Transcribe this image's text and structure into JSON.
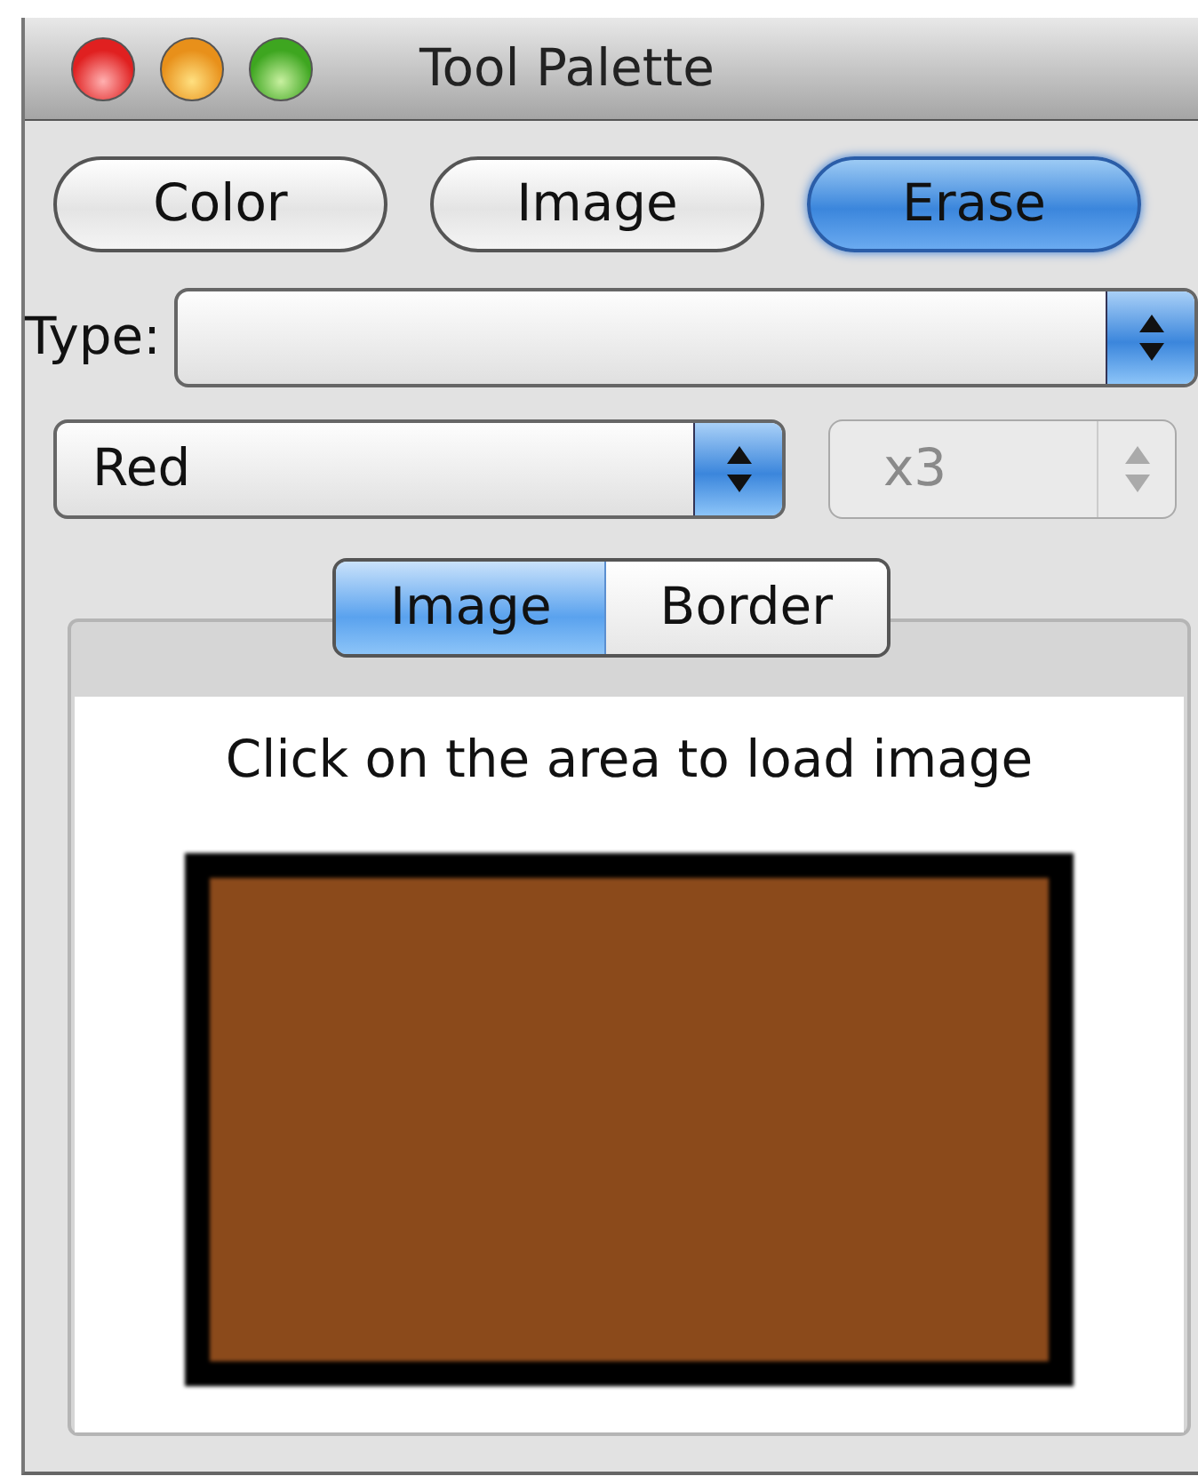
{
  "window": {
    "title": "Tool Palette"
  },
  "buttons": [
    {
      "label": "Color",
      "selected": false
    },
    {
      "label": "Image",
      "selected": false
    },
    {
      "label": "Erase",
      "selected": true
    }
  ],
  "type_popup": {
    "label": "Type:"
  },
  "color_popup": {
    "value": "Red"
  },
  "stepper": {
    "value": "x3",
    "disabled": true
  },
  "tabs": [
    {
      "label": "Image",
      "selected": true
    },
    {
      "label": "Border",
      "selected": false
    }
  ],
  "panel": {
    "message": "Click on the area to load image"
  }
}
